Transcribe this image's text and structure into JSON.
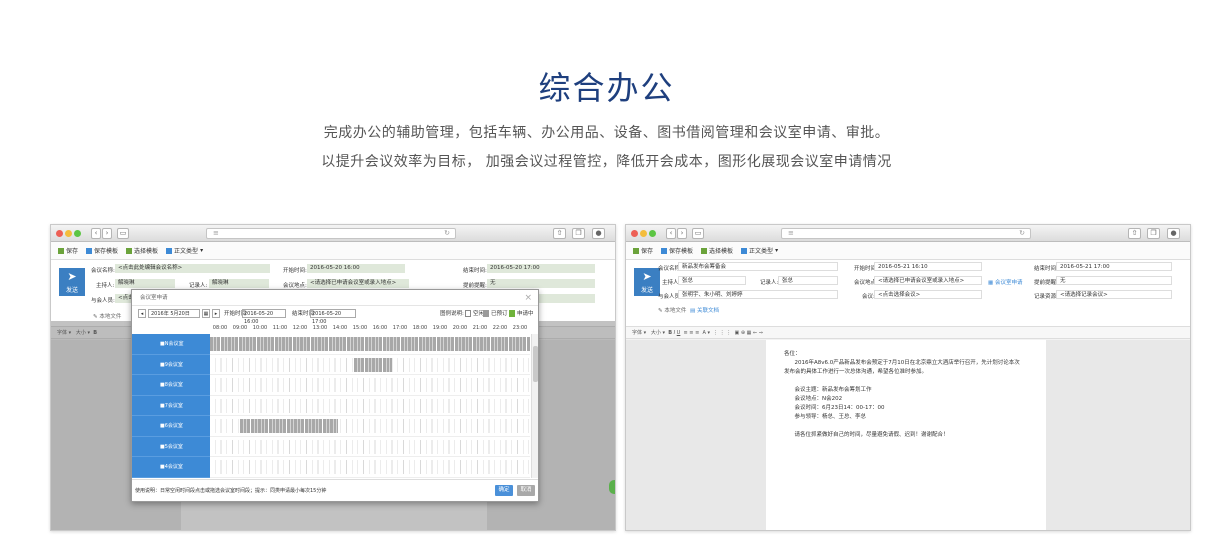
{
  "hero": {
    "title": "综合办公",
    "line1": "完成办公的辅助管理，包括车辆、办公用品、设备、图书借阅管理和会议室申请、审批。",
    "line2": "以提升会议效率为目标， 加强会议过程管控，降低开会成本，图形化展现会议室申请情况"
  },
  "left_shot": {
    "toolbar": [
      "保存",
      "保存模板",
      "选择模板",
      "正文类型"
    ],
    "form": {
      "send_label": "发送",
      "meeting_name_label": "会议名称:",
      "meeting_name_value": "<点击此处编辑会议名称>",
      "host_label": "主持人:",
      "host_value": "解晓琳",
      "recorder_label": "记录人:",
      "recorder_value": "解晓琳",
      "start_label": "开始时间:",
      "start_value": "2016-05-20 16:00",
      "end_label": "结束时间:",
      "end_value": "2016-05-20 17:00",
      "attendee_label": "与会人员:",
      "attendee_value": "<点击此",
      "place_label": "会议地点:",
      "place_value": "<请选择已申请会议室或录入地点>",
      "remind_label": "提前提醒:",
      "remind_value": "无",
      "attach_label": "本地文件",
      "font_label": "字体",
      "size_label": "大小"
    },
    "dialog": {
      "title": "会议室申请",
      "date_value": "2016年 5月20日",
      "start_label": "开始时间",
      "start_value": "2016-05-20 16:00",
      "end_label": "结束时间",
      "end_value": "2016-05-20 17:00",
      "legend_label": "图例说明:",
      "legend_free": "空闲",
      "legend_booked": "已预订",
      "legend_applying": "申请中",
      "ticks": [
        "08:00",
        "09:00",
        "10:00",
        "11:00",
        "12:00",
        "13:00",
        "14:00",
        "15:00",
        "16:00",
        "17:00",
        "18:00",
        "19:00",
        "20:00",
        "21:00",
        "22:00",
        "23:00"
      ],
      "rooms": [
        "N会议室",
        "9会议室",
        "8会议室",
        "7会议室",
        "6会议室",
        "5会议室",
        "4会议室",
        "3会议室"
      ],
      "footer_note": "使用说明：日常空闲时间段点击或拖选会议室时间段；提示：同类申请最小每次15分钟",
      "ok_label": "确定",
      "cancel_label": "取消"
    }
  },
  "right_shot": {
    "toolbar": [
      "保存",
      "保存模板",
      "选择模板",
      "正文类型"
    ],
    "form": {
      "send_label": "发送",
      "meeting_name_label": "会议名称:",
      "meeting_name_value": "新品发布会筹备会",
      "host_label": "主持人:",
      "host_value": "张总",
      "recorder_label": "记录人:",
      "recorder_value": "张总",
      "attendee_label": "与会人员:",
      "attendee_value": "张明宇、朱小明、刘婷婷",
      "start_label": "开始时间:",
      "start_value": "2016-05-21 16:10",
      "end_label": "结束时间:",
      "end_value": "2016-05-21 17:00",
      "place_label": "会议地点:",
      "place_value": "<请选择已申请会议室或录入地点>",
      "remind_label": "提前提醒:",
      "remind_value": "无",
      "link_label": "会议:",
      "link_value": "<点击选择会议>",
      "record_label": "记录资源:",
      "record_value": "<请选择记录会议>",
      "booked_label": "会议室申请",
      "attach_label": "本地文件",
      "attach2_label": "关联文档",
      "font_label": "字体",
      "size_label": "大小"
    },
    "letter": {
      "greeting": "各位：",
      "body1": "      2016年A8v6.0产品新品发布会预定于7月10日在北京鼎立大酒店举行召开，先计划讨论本次",
      "body2": "发布会的具体工作进行一次总体沟通，希望各位准时参加。",
      "topic": "      会议主题：新品发布会筹划工作",
      "place": "      会议地点：N会202",
      "time": "      会议时间：6月23日14：00-17：00",
      "people": "      参与领导：杨总、王总、李总",
      "closing": "      请各位抓紧做好自己的时间，尽量避免请假、迟到！谢谢配合！"
    }
  }
}
